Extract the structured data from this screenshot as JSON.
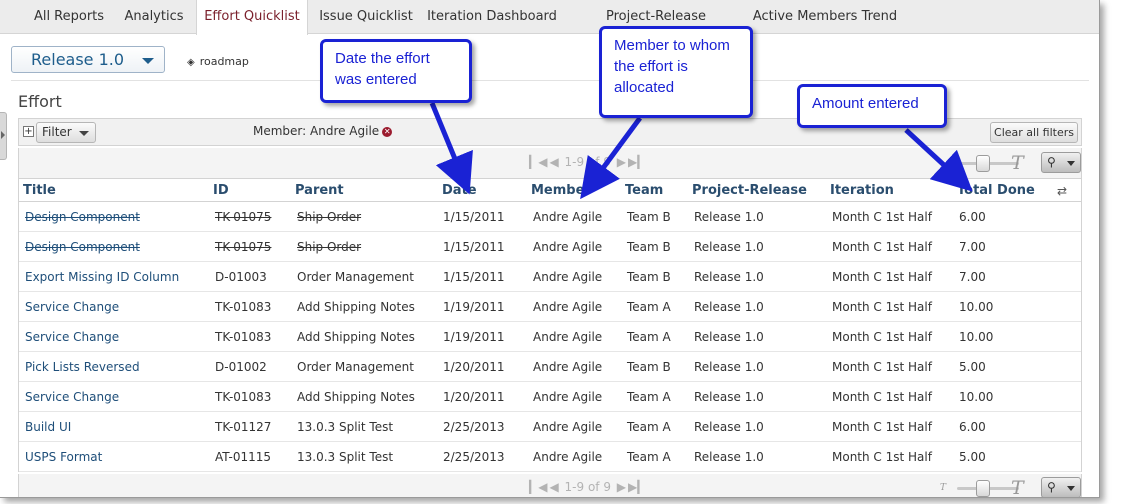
{
  "tabs": [
    {
      "label": "All Reports"
    },
    {
      "label": "Analytics"
    },
    {
      "label": "Effort Quicklist"
    },
    {
      "label": "Issue Quicklist"
    },
    {
      "label": "Iteration Dashboard"
    },
    {
      "label": "Project-Release Dashboard"
    },
    {
      "label": "Active Members Trend"
    }
  ],
  "active_tab": "Effort Quicklist",
  "release_select": {
    "value": "Release 1.0"
  },
  "roadmap_link": "roadmap",
  "section_title": "Effort",
  "filter": {
    "button_label": "Filter",
    "member_filter": "Member: Andre Agile",
    "clear_label": "Clear all filters"
  },
  "pager": {
    "text": "1-9 of 9"
  },
  "columns": [
    "Title",
    "ID",
    "Parent",
    "Date",
    "Member",
    "Team",
    "Project-Release",
    "Iteration",
    "Total Done"
  ],
  "rows": [
    {
      "title": "Design Component",
      "id": "TK-01075",
      "parent": "Ship Order",
      "date": "1/15/2011",
      "member": "Andre Agile",
      "team": "Team B",
      "release": "Release 1.0",
      "iteration": "Month C 1st Half",
      "done": "6.00",
      "closed": true
    },
    {
      "title": "Design Component",
      "id": "TK-01075",
      "parent": "Ship Order",
      "date": "1/15/2011",
      "member": "Andre Agile",
      "team": "Team B",
      "release": "Release 1.0",
      "iteration": "Month C 1st Half",
      "done": "7.00",
      "closed": true
    },
    {
      "title": "Export Missing ID Column",
      "id": "D-01003",
      "parent": "Order Management",
      "date": "1/15/2011",
      "member": "Andre Agile",
      "team": "Team B",
      "release": "Release 1.0",
      "iteration": "Month C 1st Half",
      "done": "7.00",
      "closed": false
    },
    {
      "title": "Service Change",
      "id": "TK-01083",
      "parent": "Add Shipping Notes",
      "date": "1/19/2011",
      "member": "Andre Agile",
      "team": "Team A",
      "release": "Release 1.0",
      "iteration": "Month C 1st Half",
      "done": "10.00",
      "closed": false
    },
    {
      "title": "Service Change",
      "id": "TK-01083",
      "parent": "Add Shipping Notes",
      "date": "1/19/2011",
      "member": "Andre Agile",
      "team": "Team A",
      "release": "Release 1.0",
      "iteration": "Month C 1st Half",
      "done": "10.00",
      "closed": false
    },
    {
      "title": "Pick Lists Reversed",
      "id": "D-01002",
      "parent": "Order Management",
      "date": "1/20/2011",
      "member": "Andre Agile",
      "team": "Team B",
      "release": "Release 1.0",
      "iteration": "Month C 1st Half",
      "done": "5.00",
      "closed": false
    },
    {
      "title": "Service Change",
      "id": "TK-01083",
      "parent": "Add Shipping Notes",
      "date": "1/20/2011",
      "member": "Andre Agile",
      "team": "Team A",
      "release": "Release 1.0",
      "iteration": "Month C 1st Half",
      "done": "10.00",
      "closed": false
    },
    {
      "title": "Build UI",
      "id": "TK-01127",
      "parent": "13.0.3 Split Test",
      "date": "2/25/2013",
      "member": "Andre Agile",
      "team": "Team A",
      "release": "Release 1.0",
      "iteration": "Month C 1st Half",
      "done": "6.00",
      "closed": false
    },
    {
      "title": "USPS Format",
      "id": "AT-01115",
      "parent": "13.0.3 Split Test",
      "date": "2/25/2013",
      "member": "Andre Agile",
      "team": "Team A",
      "release": "Release 1.0",
      "iteration": "Month C 1st Half",
      "done": "5.00",
      "closed": false
    }
  ],
  "callouts": {
    "date": "Date the effort was entered",
    "member": "Member to whom the effort is allocated",
    "amount": "Amount entered"
  },
  "colors": {
    "active_tab": "#7a1f2b",
    "callout": "#1a22d4",
    "header_text": "#2a4d6e",
    "link": "#1e4e79"
  }
}
